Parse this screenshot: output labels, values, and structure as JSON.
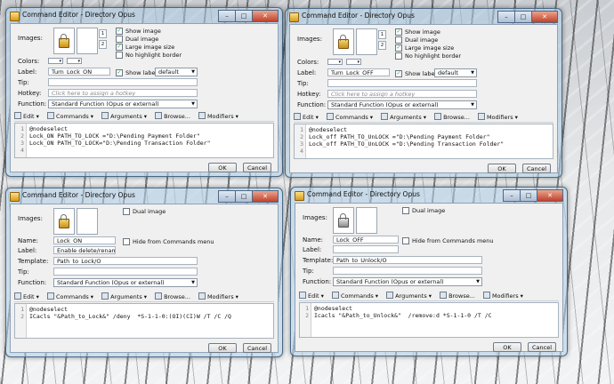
{
  "dialogs": [
    {
      "title": "Command Editor - Directory Opus",
      "labels": {
        "images": "Images:",
        "colors": "Colors:",
        "label": "Label:",
        "tip": "Tip:",
        "hotkey": "Hotkey:",
        "function": "Function:"
      },
      "checkboxes": [
        "Show image",
        "Dual image",
        "Large image size",
        "No highlight border"
      ],
      "checked": [
        true,
        false,
        true,
        false
      ],
      "label_value": "Turn_Lock_ON",
      "show_label": "Show label",
      "show_label_value": "default",
      "hotkey_placeholder": "Click here to assign a hotkey",
      "function_value": "Standard Function (Opus or external)",
      "toolbar": [
        "Edit",
        "Commands",
        "Arguments",
        "Browse...",
        "Modifiers"
      ],
      "lines": [
        "@nodeselect",
        "Lock_ON PATH_TO_LOCK =\"D:\\Pending Payment Folder\"",
        "Lock_ON PATH_TO_LOCK=\"D:\\Pending Transaction Folder\""
      ],
      "line_numbers": [
        "1",
        "2",
        "3",
        "4"
      ],
      "ok": "OK",
      "cancel": "Cancel"
    },
    {
      "title": "Command Editor - Directory Opus",
      "labels": {
        "images": "Images:",
        "colors": "Colors:",
        "label": "Label:",
        "tip": "Tip:",
        "hotkey": "Hotkey:",
        "function": "Function:"
      },
      "checkboxes": [
        "Show image",
        "Dual image",
        "Large image size",
        "No highlight border"
      ],
      "checked": [
        true,
        false,
        true,
        false
      ],
      "label_value": "Turn_Lock_OFF",
      "show_label": "Show label",
      "show_label_value": "default",
      "hotkey_placeholder": "Click here to assign a hotkey",
      "function_value": "Standard Function (Opus or external)",
      "toolbar": [
        "Edit",
        "Commands",
        "Arguments",
        "Browse...",
        "Modifiers"
      ],
      "lines": [
        "@nodeselect",
        "Lock_off PATH_TO_UnLOCK =\"D:\\Pending Payment Folder\"",
        "Lock_off PATH_TO_UnLOCK =\"D:\\Pending Transaction Folder\""
      ],
      "line_numbers": [
        "1",
        "2",
        "3",
        "4"
      ],
      "ok": "OK",
      "cancel": "Cancel"
    },
    {
      "title": "Command Editor - Directory Opus",
      "labels": {
        "images": "Images:",
        "name": "Name:",
        "label": "Label:",
        "template": "Template:",
        "tip": "Tip:",
        "function": "Function:"
      },
      "dual_image": "Dual image",
      "name_value": "Lock_ON",
      "hide_label": "Hide from Commands menu",
      "label_value": "Enable delete/rename pr",
      "template_value": "Path_to_Lock/O",
      "function_value": "Standard Function (Opus or external)",
      "toolbar": [
        "Edit",
        "Commands",
        "Arguments",
        "Browse...",
        "Modifiers"
      ],
      "lines": [
        "@nodeselect",
        "ICacls \"&Path_to_Lock&\" /deny  *S-1-1-0:(OI)(CI)W /T /C /Q"
      ],
      "line_numbers": [
        "1",
        "2"
      ],
      "ok": "OK",
      "cancel": "Cancel"
    },
    {
      "title": "Command Editor - Directory Opus",
      "labels": {
        "images": "Images:",
        "name": "Name:",
        "label": "Label:",
        "template": "Template:",
        "tip": "Tip:",
        "function": "Function:"
      },
      "dual_image": "Dual image",
      "name_value": "Lock_OFF",
      "hide_label": "Hide from Commands menu",
      "label_value": "",
      "template_value": "Path_to_Unlock/O",
      "function_value": "Standard Function (Opus or external)",
      "toolbar": [
        "Edit",
        "Commands",
        "Arguments",
        "Browse...",
        "Modifiers"
      ],
      "lines": [
        "@nodeselect",
        "Icacls \"&Path_to_Unlock&\"  /remove:d *S-1-1-0 /T /C"
      ],
      "line_numbers": [
        "1",
        "2"
      ],
      "ok": "OK",
      "cancel": "Cancel"
    }
  ],
  "icons": {
    "title": "opus-icon",
    "image": "lock-icon",
    "close": "close-icon"
  }
}
